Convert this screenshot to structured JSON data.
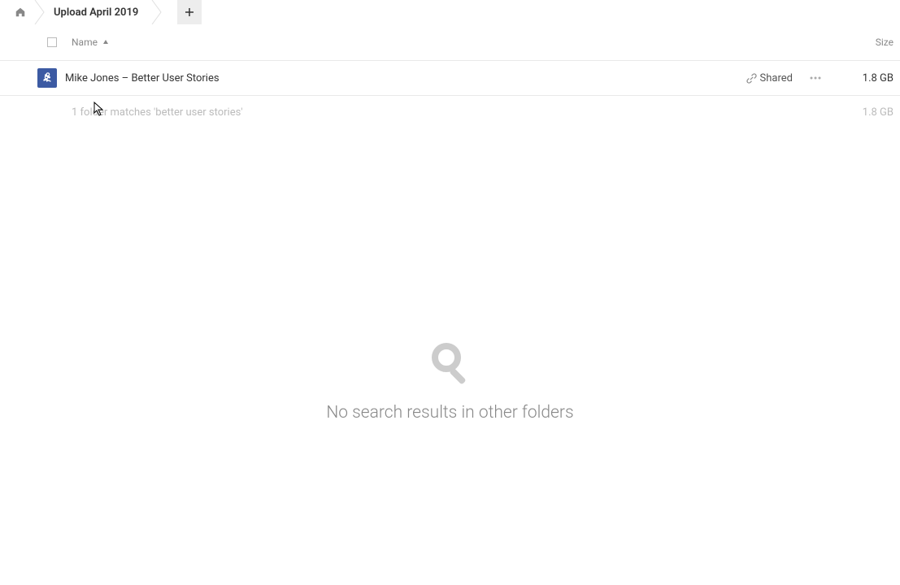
{
  "breadcrumb": {
    "current": "Upload April 2019"
  },
  "columns": {
    "name": "Name",
    "size": "Size"
  },
  "files": [
    {
      "name": "Mike Jones – Better User Stories",
      "shared_label": "Shared",
      "size": "1.8 GB"
    }
  ],
  "summary": {
    "text": "1 folder matches 'better user stories'",
    "size": "1.8 GB"
  },
  "empty_state": {
    "text": "No search results in other folders"
  }
}
